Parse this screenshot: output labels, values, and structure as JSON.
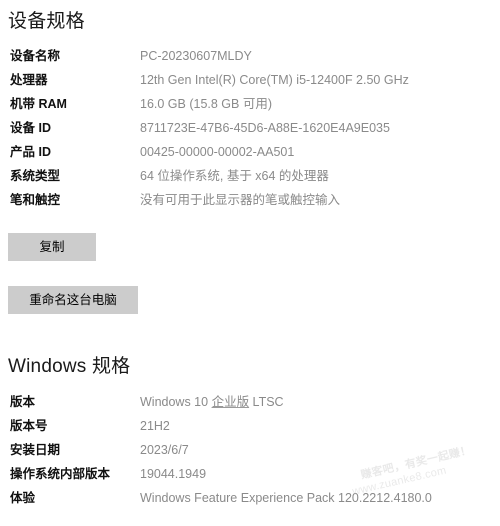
{
  "device_section": {
    "heading": "设备规格",
    "rows": [
      {
        "label": "设备名称",
        "value": "PC-20230607MLDY"
      },
      {
        "label": "处理器",
        "value": "12th Gen Intel(R) Core(TM) i5-12400F   2.50 GHz"
      },
      {
        "label": "机带 RAM",
        "value": "16.0 GB (15.8 GB 可用)"
      },
      {
        "label": "设备 ID",
        "value": "8711723E-47B6-45D6-A88E-1620E4A9E035"
      },
      {
        "label": "产品 ID",
        "value": "00425-00000-00002-AA501"
      },
      {
        "label": "系统类型",
        "value": "64 位操作系统, 基于 x64 的处理器"
      },
      {
        "label": "笔和触控",
        "value": "没有可用于此显示器的笔或触控输入"
      }
    ],
    "copy_button": "复制",
    "rename_button": "重命名这台电脑"
  },
  "windows_section": {
    "heading": "Windows 规格",
    "rows": [
      {
        "label": "版本",
        "value": "Windows 10 企业版 LTSC",
        "value_prefix": "Windows 10 ",
        "value_underlined": "企业版",
        "value_suffix": " LTSC"
      },
      {
        "label": "版本号",
        "value": "21H2"
      },
      {
        "label": "安装日期",
        "value": "2023/6/7"
      },
      {
        "label": "操作系统内部版本",
        "value": "19044.1949"
      },
      {
        "label": "体验",
        "value": "Windows Feature Experience Pack 120.2212.4180.0"
      }
    ]
  },
  "watermark": {
    "line1": "赚客吧，有奖一起赚！",
    "line2": "www.zuanke8.com"
  },
  "colors": {
    "label_text": "#111111",
    "value_text": "#8a8a8a",
    "heading_text": "#1a1a1a",
    "button_bg": "#cccccc",
    "page_bg": "#ffffff"
  }
}
